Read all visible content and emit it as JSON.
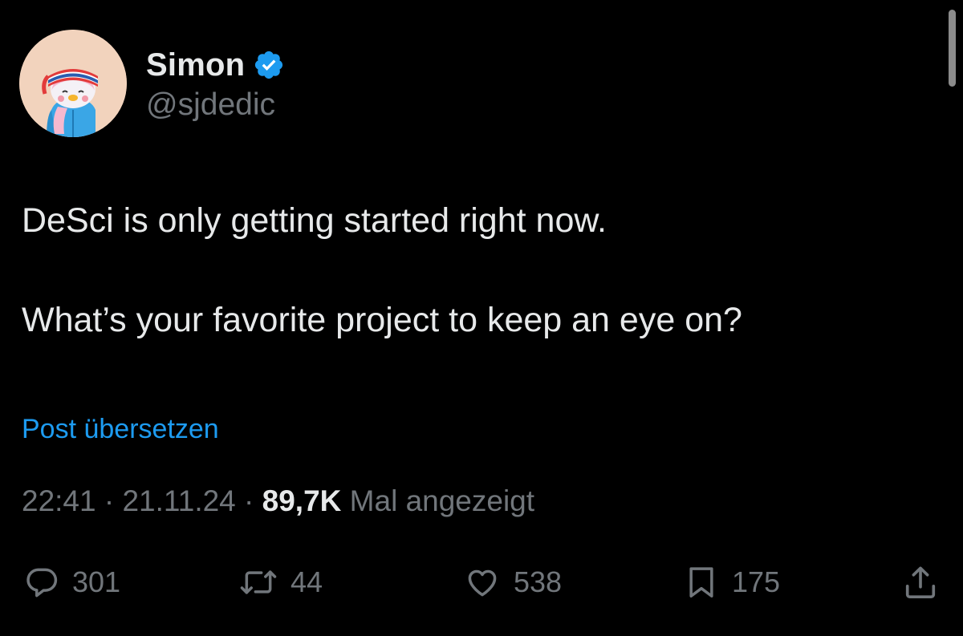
{
  "author": {
    "display_name": "Simon",
    "handle": "@sjdedic",
    "verified": true,
    "avatar_icon": "penguin-avatar",
    "verified_icon": "verified-badge-icon"
  },
  "tweet": {
    "paragraphs": [
      "DeSci is only getting started right now.",
      "What’s your favorite project to keep an eye on?"
    ],
    "translate_label": "Post übersetzen",
    "time": "22:41",
    "date": "21.11.24",
    "separator": "·",
    "views_count": "89,7K",
    "views_label": "Mal angezeigt"
  },
  "actions": {
    "replies": {
      "count": "301",
      "icon": "reply-icon"
    },
    "reposts": {
      "count": "44",
      "icon": "repost-icon"
    },
    "likes": {
      "count": "538",
      "icon": "heart-icon"
    },
    "bookmarks": {
      "count": "175",
      "icon": "bookmark-icon"
    },
    "share": {
      "icon": "share-icon"
    }
  },
  "colors": {
    "background": "#000000",
    "primary_text": "#e7e9ea",
    "secondary_text": "#71767b",
    "accent": "#1d9bf0"
  }
}
